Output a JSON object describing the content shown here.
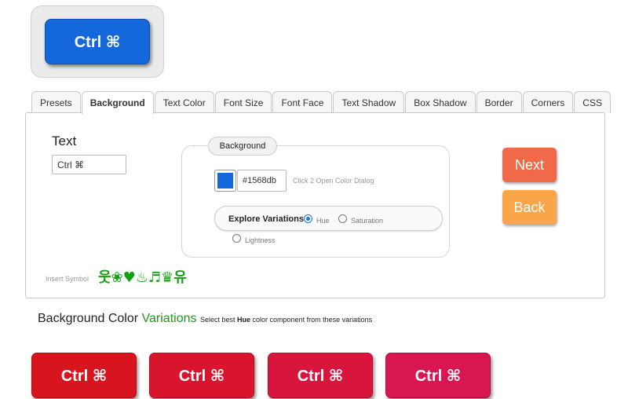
{
  "preview": {
    "label": "Ctrl ⌘",
    "color": "#1568db"
  },
  "tabs": [
    {
      "label": "Presets"
    },
    {
      "label": "Background",
      "active": true
    },
    {
      "label": "Text Color"
    },
    {
      "label": "Font Size"
    },
    {
      "label": "Font Face"
    },
    {
      "label": "Text Shadow"
    },
    {
      "label": "Box Shadow"
    },
    {
      "label": "Border"
    },
    {
      "label": "Corners"
    },
    {
      "label": "CSS"
    }
  ],
  "text_section": {
    "label": "Text",
    "value": "Ctrl ⌘"
  },
  "background": {
    "title": "Background",
    "color": "#1568db",
    "hex_value": "#1568db",
    "hint": "Click 2 Open Color Dialog",
    "explore_label": "Explore Variations",
    "options": [
      {
        "label": "Hue",
        "checked": true
      },
      {
        "label": "Saturation",
        "checked": false
      },
      {
        "label": "Lightness",
        "checked": false
      }
    ]
  },
  "nav": {
    "next_label": "Next",
    "next_color": "#f06a4a",
    "back_label": "Back",
    "back_color": "#f9a54a"
  },
  "insert_symbol": {
    "label": "Insert Symbol",
    "symbols": "웃❀♥♨♬♛유"
  },
  "variations": {
    "title_main": "Background Color",
    "title_green": "Variations",
    "desc_pre": "Select best",
    "desc_bold": "Hue",
    "desc_post": "color component from these variations",
    "buttons": [
      {
        "label": "Ctrl ⌘",
        "color": "#d8141e"
      },
      {
        "label": "Ctrl ⌘",
        "color": "#d8152c"
      },
      {
        "label": "Ctrl ⌘",
        "color": "#d8153c"
      },
      {
        "label": "Ctrl ⌘",
        "color": "#d8164f"
      }
    ]
  }
}
